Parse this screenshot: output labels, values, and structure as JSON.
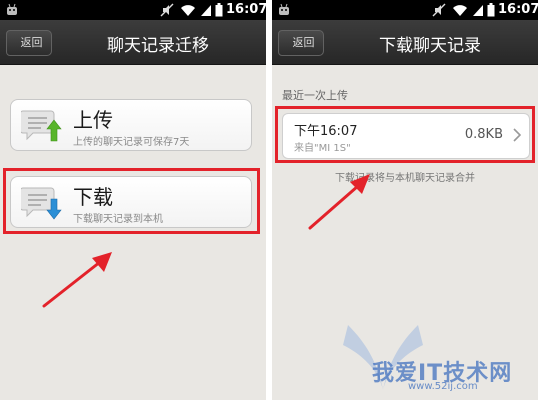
{
  "colors": {
    "highlight": "#e3222a",
    "upload_arrow": "#58b52a",
    "download_arrow": "#2b8fd6",
    "watermark": "#3c6ebe"
  },
  "left_screen": {
    "status_bar": {
      "clock": "16:07"
    },
    "title_bar": {
      "back_label": "返回",
      "title": "聊天记录迁移"
    },
    "options": [
      {
        "title": "上传",
        "subtitle": "上传的聊天记录可保存7天",
        "icon": "upload-chat-icon"
      },
      {
        "title": "下载",
        "subtitle": "下载聊天记录到本机",
        "icon": "download-chat-icon"
      }
    ]
  },
  "right_screen": {
    "status_bar": {
      "clock": "16:07"
    },
    "title_bar": {
      "back_label": "返回",
      "title": "下载聊天记录"
    },
    "section_label": "最近一次上传",
    "record": {
      "time": "下午16:07",
      "source": "来自\"MI 1S\"",
      "size": "0.8KB"
    },
    "note": "下载记录将与本机聊天记录合并"
  },
  "watermark": {
    "title": "我爱IT技术网",
    "url": "www.52ij.com"
  }
}
